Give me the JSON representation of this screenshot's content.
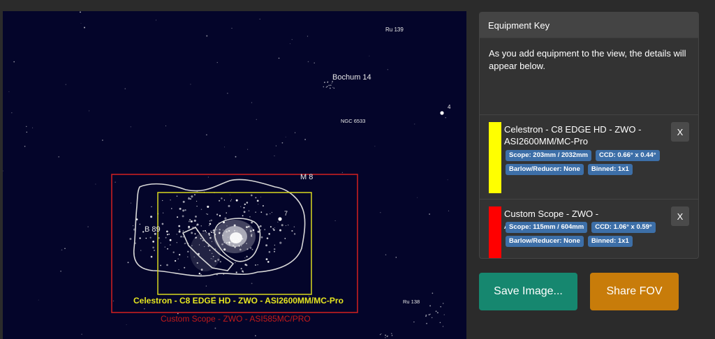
{
  "sky": {
    "labels": {
      "ru139": "Ru 139",
      "bochum14": "Bochum 14",
      "ngc6533": "NGC 6533",
      "star4": "4",
      "m8": "M 8",
      "b89": "B 89",
      "star7": "7",
      "ru138": "Ru 138"
    },
    "fov_captions": {
      "yellow": "Celestron - C8 EDGE HD - ZWO - ASI2600MM/MC-Pro",
      "red": "Custom Scope - ZWO - ASI585MC/PRO"
    }
  },
  "panel": {
    "title": "Equipment Key",
    "intro": "As you add equipment to the view, the details will appear below.",
    "equipment": [
      {
        "color": "#ffff00",
        "name": "Celestron - C8 EDGE HD - ZWO - ASI2600MM/MC-Pro",
        "scope": "Scope: 203mm / 2032mm",
        "ccd": "CCD: 0.66° x 0.44°",
        "barlow": "Barlow/Reducer: None",
        "binned": "Binned: 1x1",
        "close_label": "X"
      },
      {
        "color": "#ff0000",
        "name": "Custom Scope - ZWO - ASI585MC/PRO",
        "scope": "Scope: 115mm / 604mm",
        "ccd": "CCD: 1.06° x 0.59°",
        "barlow": "Barlow/Reducer: None",
        "binned": "Binned: 1x1",
        "close_label": "X"
      }
    ]
  },
  "buttons": {
    "save": "Save Image...",
    "share": "Share FOV"
  },
  "colors": {
    "sky_background": "#04052a",
    "save_button": "#16876f",
    "share_button": "#c87c0a",
    "tag": "#3d6fa8"
  }
}
